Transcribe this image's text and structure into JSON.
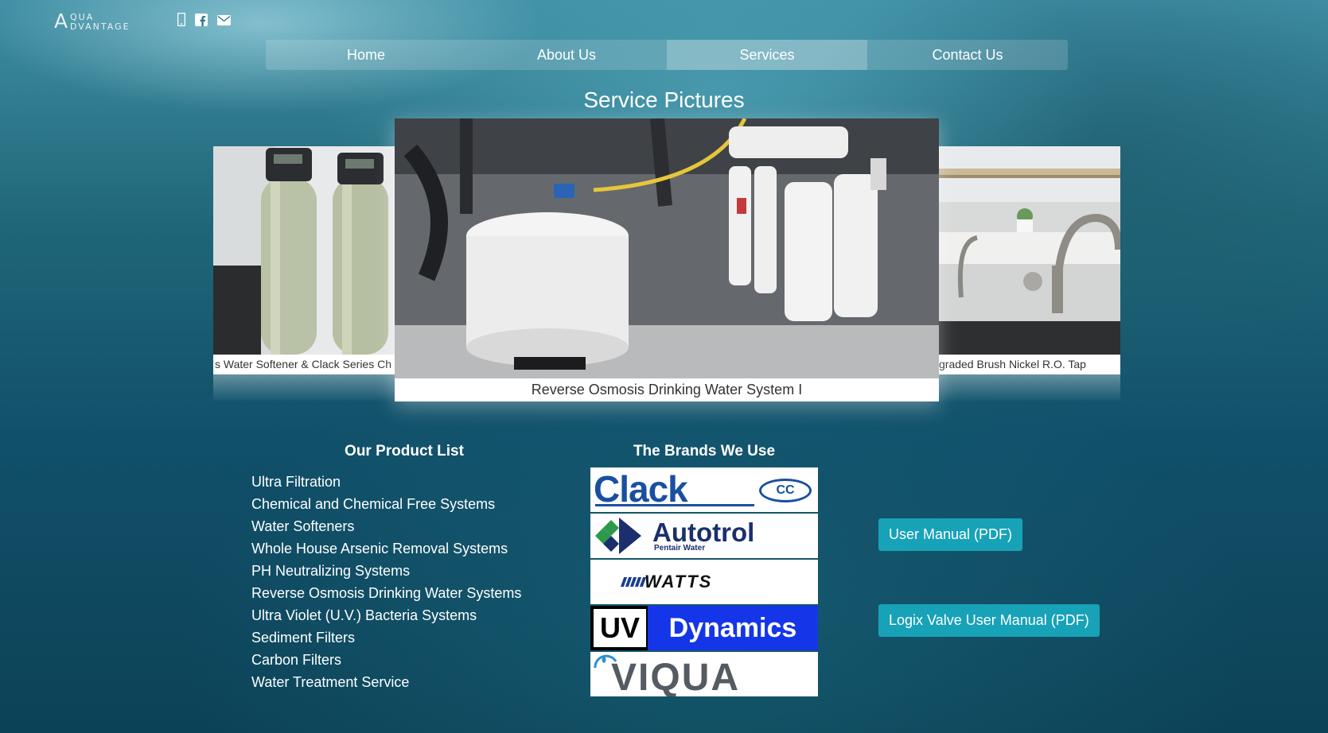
{
  "header": {
    "logo_big_letter": "A",
    "logo_line1": "QUA",
    "logo_line2": "DVANTAGE",
    "icons": [
      "mobile-phone-icon",
      "facebook-icon",
      "envelope-icon"
    ]
  },
  "nav": {
    "items": [
      {
        "label": "Home"
      },
      {
        "label": "About Us"
      },
      {
        "label": "Services"
      },
      {
        "label": "Contact Us"
      }
    ],
    "active": "Services"
  },
  "gallery": {
    "title": "Service Pictures",
    "left_caption": "s Water Softener & Clack Series Ch",
    "center_caption": "Reverse Osmosis Drinking Water System I",
    "right_caption": "graded Brush Nickel R.O. Tap"
  },
  "products": {
    "heading": "Our Product List",
    "items": [
      "Ultra Filtration",
      "Chemical and Chemical Free Systems",
      "Water Softeners",
      "Whole House Arsenic Removal Systems",
      "PH Neutralizing Systems",
      "Reverse Osmosis Drinking Water Systems",
      "Ultra Violet (U.V.) Bacteria Systems",
      "Sediment Filters",
      "Carbon Filters",
      "Water Treatment Service"
    ]
  },
  "brands": {
    "heading": "The Brands We Use",
    "logos": [
      {
        "text": "Clack",
        "badge": "CC"
      },
      {
        "text": "Autotrol",
        "subtext": "Pentair Water"
      },
      {
        "text": "WATTS"
      },
      {
        "text_a": "UV",
        "text_b": "Dynamics"
      },
      {
        "text": "VIQUA"
      }
    ]
  },
  "downloads": {
    "user_manual": "User Manual (PDF)",
    "logix_manual": "Logix Valve User Manual (PDF)"
  },
  "colors": {
    "button": "#17a2b8",
    "clack_blue": "#1a4fa0",
    "autotrol_navy": "#1b2f6e",
    "uv_blue": "#1536e8",
    "viqua_gray": "#555b62"
  }
}
